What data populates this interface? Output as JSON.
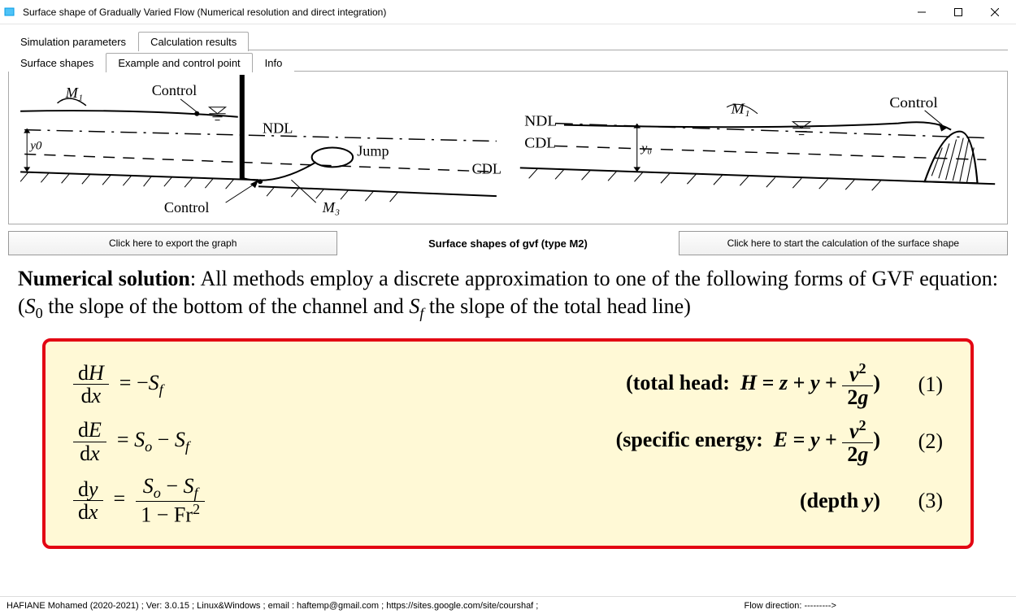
{
  "window": {
    "title": "Surface shape of Gradually Varied Flow (Numerical resolution and direct integration)"
  },
  "tabs_outer": [
    {
      "label": "Simulation parameters",
      "active": false
    },
    {
      "label": "Calculation results",
      "active": true
    }
  ],
  "tabs_inner": [
    {
      "label": "Surface shapes",
      "active": false
    },
    {
      "label": "Example and control point",
      "active": true
    },
    {
      "label": "Info",
      "active": false
    }
  ],
  "diagram_labels": {
    "left": {
      "M1": "M₁",
      "Control_top": "Control",
      "NDL": "NDL",
      "Jump": "Jump",
      "CDL": "CDL",
      "Control_bottom": "Control",
      "M3": "M₃",
      "y0": "y0"
    },
    "right": {
      "NDL": "NDL",
      "CDL": "CDL",
      "M1": "M₁",
      "Control": "Control",
      "y0": "y₀"
    }
  },
  "buttons": {
    "export": "Click here to export the graph",
    "center": "Surface shapes of gvf (type M2)",
    "calculate": "Click here to start the calculation of the surface shape"
  },
  "explain": {
    "heading": "Numerical solution",
    "body1": ": All methods employ a discrete approximation to one of the following forms of GVF equation: (",
    "S0": "S₀",
    "body2": " the slope of the bottom of the channel and ",
    "Sf": "S_f",
    "body3": " the slope of the total head line)"
  },
  "equations": {
    "eq1": {
      "lhs_top": "dH",
      "lhs_bot": "dx",
      "rhs": "= −S_f",
      "desc": "(total head: H = z + y + v²⁄2g)",
      "num": "(1)"
    },
    "eq2": {
      "lhs_top": "dE",
      "lhs_bot": "dx",
      "rhs": "= Sₒ − S_f",
      "desc": "(specific energy: E = y + v²⁄2g)",
      "num": "(2)"
    },
    "eq3": {
      "lhs_top": "dy",
      "lhs_bot": "dx",
      "rhs_top": "Sₒ − S_f",
      "rhs_bot": "1 − Fr²",
      "desc": "(depth y)",
      "num": "(3)"
    }
  },
  "status": {
    "left": "HAFIANE Mohamed (2020-2021) ; Ver: 3.0.15 ; Linux&Windows ; email : haftemp@gmail.com ; https://sites.google.com/site/courshaf       ;",
    "right": "Flow direction: --------->"
  }
}
